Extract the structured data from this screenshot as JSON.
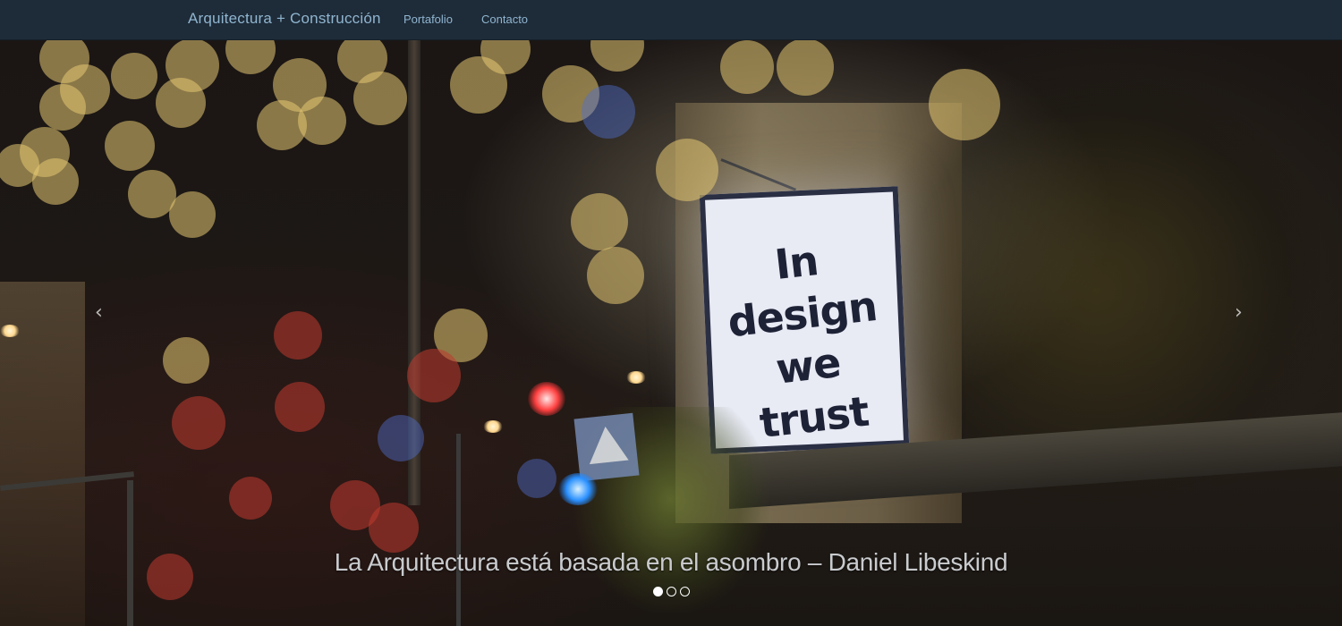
{
  "navbar": {
    "brand": "Arquitectura + Construcción",
    "links": [
      {
        "label": "Portafolio"
      },
      {
        "label": "Contacto"
      }
    ]
  },
  "carousel": {
    "billboard_text": "In\ndesign\nwe\ntrust",
    "caption": "La Arquitectura está basada en el asombro – Daniel Libeskind",
    "prev_icon": "chevron-left-icon",
    "next_icon": "chevron-right-icon",
    "prev_glyph": "‹",
    "next_glyph": "›",
    "slides_count": 3,
    "active_slide": 1
  },
  "colors": {
    "navbar_bg": "#1e2b38",
    "nav_text": "#8fb5d0",
    "caption_text": "#c9cbce"
  }
}
